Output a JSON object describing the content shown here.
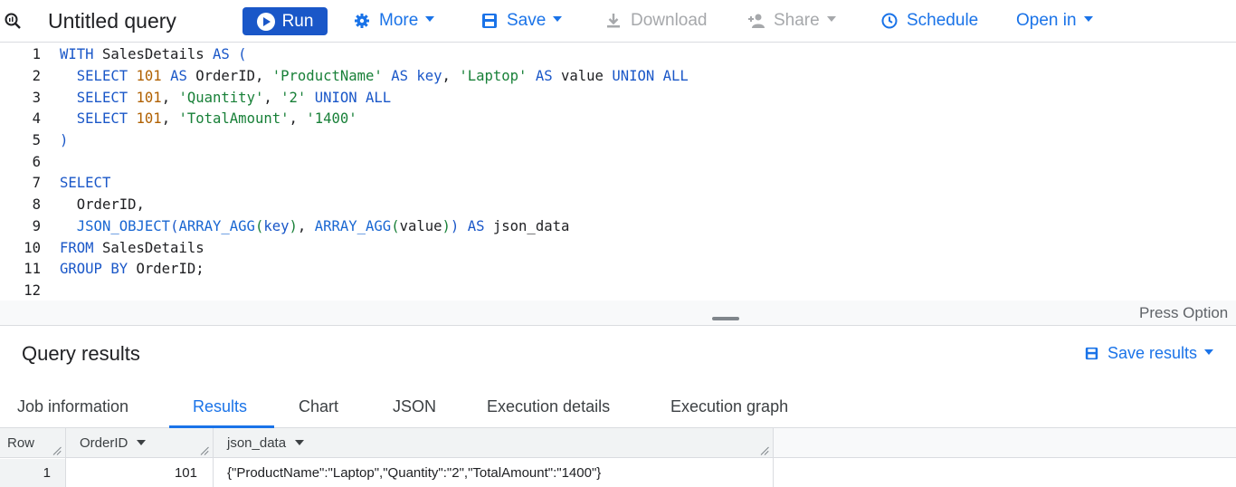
{
  "toolbar": {
    "title": "Untitled query",
    "run_label": "Run",
    "more_label": "More",
    "save_label": "Save",
    "download_label": "Download",
    "share_label": "Share",
    "schedule_label": "Schedule",
    "open_in_label": "Open in"
  },
  "editor": {
    "line_numbers": [
      "1",
      "2",
      "3",
      "4",
      "5",
      "6",
      "7",
      "8",
      "9",
      "10",
      "11",
      "12"
    ],
    "press_hint": "Press Option"
  },
  "results": {
    "title": "Query results",
    "save_results_label": "Save results",
    "tabs": [
      {
        "label": "Job information"
      },
      {
        "label": "Results"
      },
      {
        "label": "Chart"
      },
      {
        "label": "JSON"
      },
      {
        "label": "Execution details"
      },
      {
        "label": "Execution graph"
      }
    ],
    "columns": [
      "Row",
      "OrderID",
      "json_data"
    ],
    "rows": [
      {
        "row": "1",
        "order_id": "101",
        "json_data": "{\"ProductName\":\"Laptop\",\"Quantity\":\"2\",\"TotalAmount\":\"1400\"}"
      }
    ]
  },
  "colors": {
    "accent": "#1a73e8",
    "run_button": "#1a57c8",
    "keyword": "#1a57c8",
    "string": "#188038",
    "number": "#b06000"
  }
}
